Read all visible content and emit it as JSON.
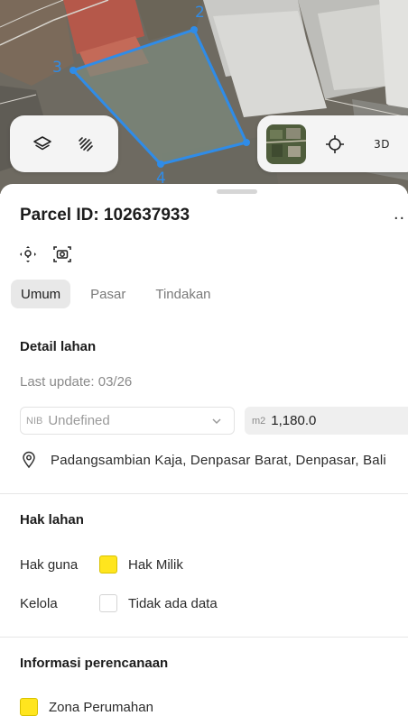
{
  "map": {
    "vertex_labels": [
      "2",
      "3",
      "4"
    ],
    "layer_icon": "layers-icon",
    "draw_icon": "draw-icon",
    "locate_icon": "crosshair-icon",
    "view_3d_label": "3D",
    "parcel_color": "#2f8ce8"
  },
  "parcel": {
    "title": "Parcel ID: 102637933",
    "more_label": "..",
    "icons": [
      "focus-parcel-icon",
      "camera-scan-icon"
    ]
  },
  "tabs": [
    {
      "label": "Umum",
      "active": true
    },
    {
      "label": "Pasar",
      "active": false
    },
    {
      "label": "Tindakan",
      "active": false
    }
  ],
  "detail": {
    "heading": "Detail lahan",
    "last_update": "Last update: 03/26",
    "nib_prefix": "NIB",
    "nib_value": "Undefined",
    "area_unit": "m2",
    "area_value": "1,180.0",
    "address": "Padangsambian Kaja, Denpasar Barat, Denpasar, Bali"
  },
  "rights": {
    "heading": "Hak lahan",
    "rows": [
      {
        "key": "Hak guna",
        "value": "Hak Milik",
        "swatch": "#ffe51e"
      },
      {
        "key": "Kelola",
        "value": "Tidak ada data",
        "swatch": ""
      }
    ]
  },
  "planning": {
    "heading": "Informasi perencanaan",
    "zone_label": "Zona Perumahan",
    "zone_color": "#ffe51e"
  }
}
